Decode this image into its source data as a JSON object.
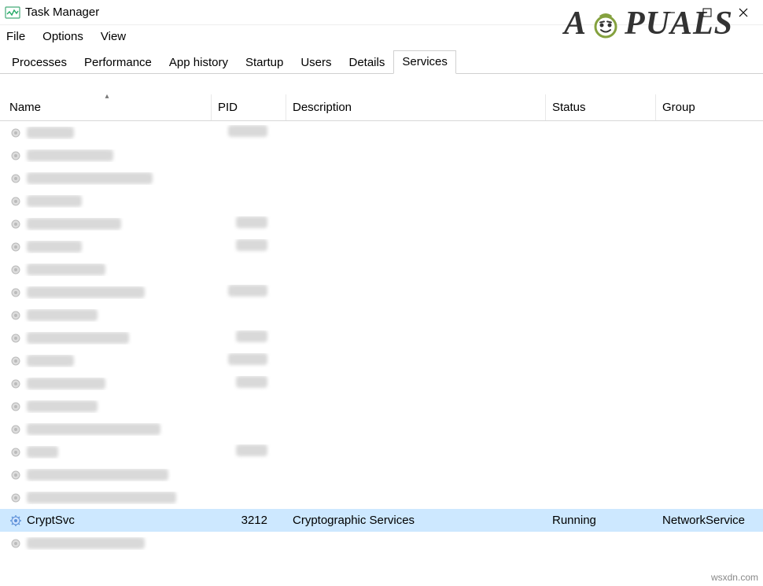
{
  "window": {
    "title": "Task Manager"
  },
  "menu": {
    "file": "File",
    "options": "Options",
    "view": "View"
  },
  "tabs": {
    "processes": "Processes",
    "performance": "Performance",
    "app_history": "App history",
    "startup": "Startup",
    "users": "Users",
    "details": "Details",
    "services": "Services",
    "active": "services"
  },
  "columns": {
    "name": "Name",
    "pid": "PID",
    "description": "Description",
    "status": "Status",
    "group": "Group",
    "sort_indicator": "▴"
  },
  "selected_row": {
    "name": "CryptSvc",
    "pid": "3212",
    "description": "Cryptographic Services",
    "status": "Running",
    "group": "NetworkService"
  },
  "blurred_rows_above": 17,
  "watermark": {
    "text_left": "A",
    "text_right": "PUALS"
  },
  "domain_text": "wsxdn.com"
}
